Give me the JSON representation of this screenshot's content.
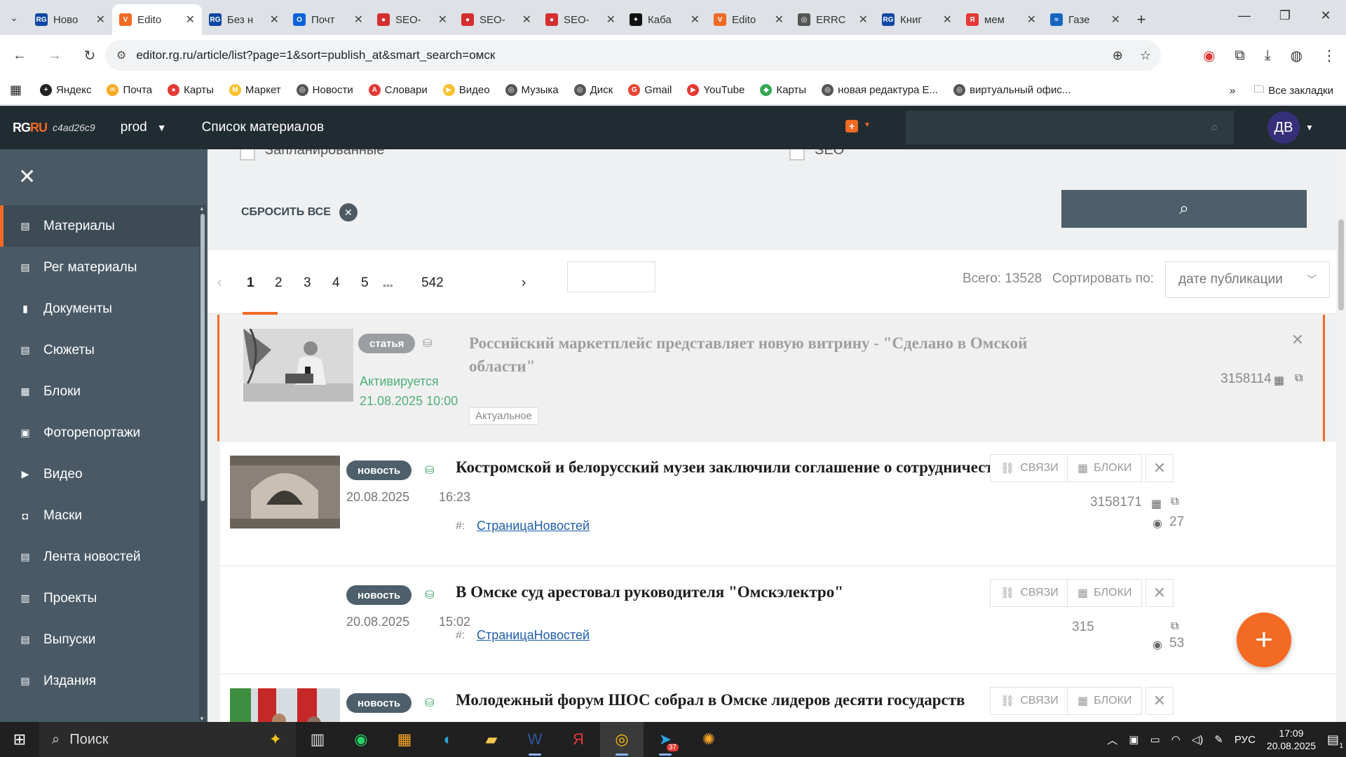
{
  "browser": {
    "tabs": [
      {
        "title": "Ново",
        "favicon": "RG",
        "color": "#0d47a1"
      },
      {
        "title": "Edito",
        "favicon": "V",
        "color": "#f26a24",
        "active": true
      },
      {
        "title": "Без н",
        "favicon": "RG",
        "color": "#0d47a1"
      },
      {
        "title": "Почт",
        "favicon": "O",
        "color": "#0a64d8"
      },
      {
        "title": "SEO-",
        "favicon": "●",
        "color": "#d32f2f"
      },
      {
        "title": "SEO-",
        "favicon": "●",
        "color": "#d32f2f"
      },
      {
        "title": "SEO-",
        "favicon": "●",
        "color": "#d32f2f"
      },
      {
        "title": "Каба",
        "favicon": "✦",
        "color": "#111111"
      },
      {
        "title": "Edito",
        "favicon": "V",
        "color": "#f26a24"
      },
      {
        "title": "ERRC",
        "favicon": "◎",
        "color": "#555555"
      },
      {
        "title": "Книг",
        "favicon": "RG",
        "color": "#0d47a1"
      },
      {
        "title": "мем",
        "favicon": "Я",
        "color": "#e53935"
      },
      {
        "title": "Газе",
        "favicon": "≈",
        "color": "#1565c0"
      }
    ],
    "url": "editor.rg.ru/article/list?page=1&sort=publish_at&smart_search=омск",
    "bookmarks": [
      {
        "label": "Яндекс",
        "color": "#222222",
        "glyph": "+"
      },
      {
        "label": "Почта",
        "color": "#f9a825",
        "glyph": "✉"
      },
      {
        "label": "Карты",
        "color": "#e53935",
        "glyph": "●"
      },
      {
        "label": "Маркет",
        "color": "#fbc02d",
        "glyph": "M"
      },
      {
        "label": "Новости",
        "color": "#555555",
        "glyph": "◎"
      },
      {
        "label": "Словари",
        "color": "#e53935",
        "glyph": "A"
      },
      {
        "label": "Видео",
        "color": "#fbc02d",
        "glyph": "▶"
      },
      {
        "label": "Музыка",
        "color": "#555555",
        "glyph": "◎"
      },
      {
        "label": "Диск",
        "color": "#555555",
        "glyph": "◎"
      },
      {
        "label": "Gmail",
        "color": "#ea4335",
        "glyph": "G"
      },
      {
        "label": "YouTube",
        "color": "#e53935",
        "glyph": "▶"
      },
      {
        "label": "Карты",
        "color": "#34a853",
        "glyph": "◆"
      },
      {
        "label": "новая редактура Е...",
        "color": "#555555",
        "glyph": "◎"
      },
      {
        "label": "виртуальный офис...",
        "color": "#555555",
        "glyph": "◎"
      }
    ],
    "all_bookmarks": "Все закладки"
  },
  "header": {
    "logo_rg": "RG",
    "logo_ru": "RU",
    "build_hash": "c4ad26c9",
    "env": "prod",
    "title": "Список материалов",
    "avatar_initials": "ДВ"
  },
  "sidebar": {
    "items": [
      {
        "label": "Материалы",
        "icon": "list-icon",
        "glyph": "▤",
        "active": true
      },
      {
        "label": "Рег материалы",
        "icon": "list-icon",
        "glyph": "▤"
      },
      {
        "label": "Документы",
        "icon": "document-icon",
        "glyph": "▮"
      },
      {
        "label": "Сюжеты",
        "icon": "list-icon",
        "glyph": "▤"
      },
      {
        "label": "Блоки",
        "icon": "grid-icon",
        "glyph": "▦"
      },
      {
        "label": "Фоторепортажи",
        "icon": "image-icon",
        "glyph": "▣"
      },
      {
        "label": "Видео",
        "icon": "play-icon",
        "glyph": "▶"
      },
      {
        "label": "Маски",
        "icon": "mask-icon",
        "glyph": "◘"
      },
      {
        "label": "Лента новостей",
        "icon": "list-icon",
        "glyph": "▤"
      },
      {
        "label": "Проекты",
        "icon": "project-icon",
        "glyph": "▥"
      },
      {
        "label": "Выпуски",
        "icon": "list-icon",
        "glyph": "▤"
      },
      {
        "label": "Издания",
        "icon": "list-icon",
        "glyph": "▤"
      }
    ]
  },
  "filters": {
    "cut_checkbox_1": "Запланированные",
    "cut_checkbox_2": "SEO",
    "reset_label": "СБРОСИТЬ ВСЕ"
  },
  "pager": {
    "pages": [
      "1",
      "2",
      "3",
      "4",
      "5",
      "•••",
      "542"
    ],
    "active_page": "1",
    "total": "Всего: 13528",
    "sort_label": "Сортировать по:",
    "sort_value": "дате публикации"
  },
  "rows": [
    {
      "type": "статья",
      "badge_color": "#9a9ea2",
      "status": "Активируется",
      "status_date": "21.08.2025 10:00",
      "title": "Российский маркетплейс представляет новую витрину - \"Сделано в Омской области\"",
      "tag_box": "Актуальное",
      "id": "3158114"
    },
    {
      "type": "новость",
      "badge_color": "#4d5f6a",
      "date": "20.08.2025",
      "time": "16:23",
      "title": "Костромской и белорусский музеи заключили соглашение о сотрудничестве",
      "hash_label": "#:",
      "tag": "СтраницаНовостей",
      "links_label": "СВЯЗИ",
      "blocks_label": "БЛОКИ",
      "id": "3158171",
      "views": "27"
    },
    {
      "type": "новость",
      "badge_color": "#4d5f6a",
      "date": "20.08.2025",
      "time": "15:02",
      "title": "В Омске суд арестовал руководителя \"Омскэлектро\"",
      "hash_label": "#:",
      "tag": "СтраницаНовостей",
      "links_label": "СВЯЗИ",
      "blocks_label": "БЛОКИ",
      "id": "315",
      "views": "53"
    },
    {
      "type": "новость",
      "badge_color": "#4d5f6a",
      "title": "Молодежный форум ШОС собрал в Омске лидеров десяти государств",
      "links_label": "СВЯЗИ",
      "blocks_label": "БЛОКИ"
    }
  ],
  "taskbar": {
    "search_label": "Поиск",
    "lang": "РУС",
    "time": "17:09",
    "date": "20.08.2025",
    "notif_count": "1",
    "telegram_badge": "37"
  },
  "colors": {
    "accent": "#f26a24",
    "header_bg": "#212b32",
    "sidebar_bg": "#495a66",
    "link": "#1f5ea8",
    "status_green": "#4fb07a"
  }
}
